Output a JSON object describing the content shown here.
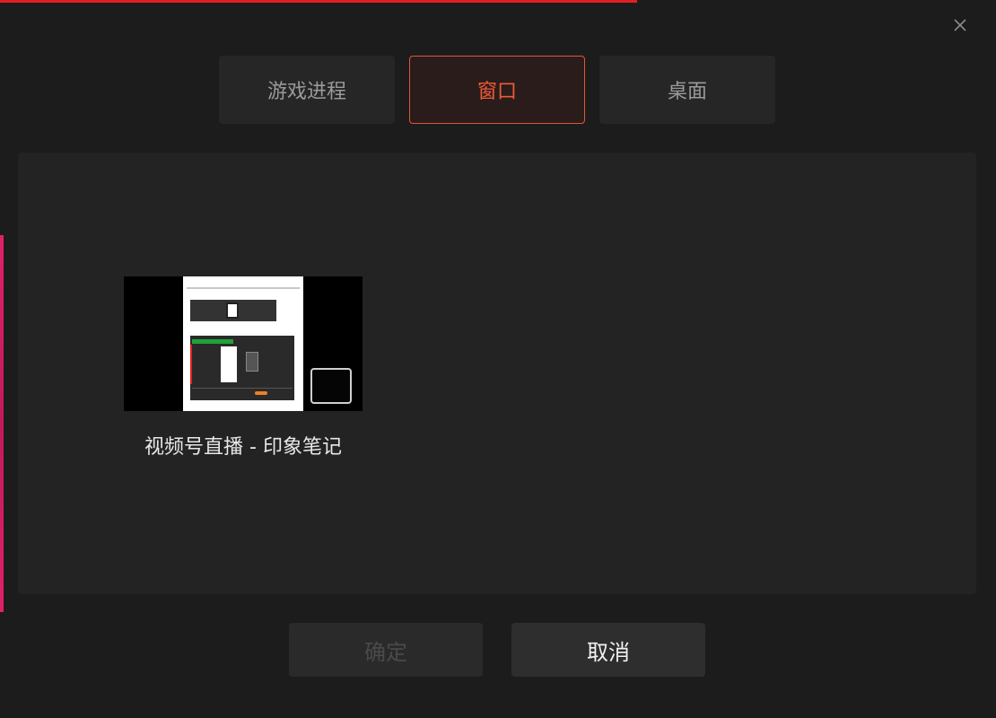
{
  "tabs": [
    {
      "label": "游戏进程",
      "active": false
    },
    {
      "label": "窗口",
      "active": true
    },
    {
      "label": "桌面",
      "active": false
    }
  ],
  "windows": [
    {
      "title": "视频号直播 - 印象笔记"
    }
  ],
  "buttons": {
    "confirm_label": "确定",
    "confirm_enabled": false,
    "cancel_label": "取消"
  },
  "icons": {
    "close": "close-icon"
  },
  "colors": {
    "accent": "#f05a3a",
    "progress": "#e02020",
    "background": "#1c1c1c",
    "panel": "#232323"
  }
}
